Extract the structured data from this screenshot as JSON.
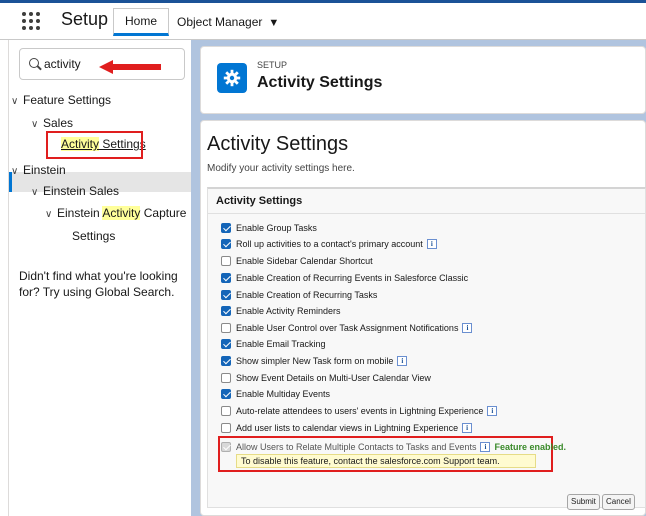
{
  "topbar": {
    "app_name": "Setup",
    "tabs": [
      {
        "label": "Home"
      },
      {
        "label": "Object Manager"
      }
    ]
  },
  "sidebar": {
    "search_value": "activity",
    "tree": {
      "feature_settings": "Feature Settings",
      "sales": "Sales",
      "activity_settings_a": "Activity",
      "activity_settings_b": " Settings",
      "einstein": "Einstein",
      "einstein_sales": "Einstein Sales",
      "eac_a": "Einstein ",
      "eac_b": "Activity",
      "eac_c": " Capture",
      "eac_settings": "Settings"
    },
    "help_text": "Didn't find what you're looking for? Try using Global Search."
  },
  "header": {
    "eyebrow": "SETUP",
    "title": "Activity Settings"
  },
  "main": {
    "title": "Activity Settings",
    "subtitle": "Modify your activity settings here.",
    "panel_title": "Activity Settings",
    "options": [
      {
        "label": "Enable Group Tasks",
        "checked": true,
        "info": false
      },
      {
        "label": "Roll up activities to a contact's primary account",
        "checked": true,
        "info": true
      },
      {
        "label": "Enable Sidebar Calendar Shortcut",
        "checked": false,
        "info": false
      },
      {
        "label": "Enable Creation of Recurring Events in Salesforce Classic",
        "checked": true,
        "info": false
      },
      {
        "label": "Enable Creation of Recurring Tasks",
        "checked": true,
        "info": false
      },
      {
        "label": "Enable Activity Reminders",
        "checked": true,
        "info": false
      },
      {
        "label": "Enable User Control over Task Assignment Notifications",
        "checked": false,
        "info": true
      },
      {
        "label": "Enable Email Tracking",
        "checked": true,
        "info": false
      },
      {
        "label": "Show simpler New Task form on mobile",
        "checked": true,
        "info": true
      },
      {
        "label": "Show Event Details on Multi-User Calendar View",
        "checked": false,
        "info": false
      },
      {
        "label": "Enable Multiday Events",
        "checked": true,
        "info": false
      },
      {
        "label": "Auto-relate attendees to users' events in Lightning Experience",
        "checked": false,
        "info": true
      },
      {
        "label": "Add user lists to calendar views in Lightning Experience",
        "checked": false,
        "info": true
      }
    ],
    "multi_contacts": {
      "label": "Allow Users to Relate Multiple Contacts to Tasks and Events",
      "status": "Feature enabled.",
      "note": "To disable this feature, contact the salesforce.com Support team."
    },
    "info_glyph": "i",
    "buttons": {
      "submit": "Submit",
      "cancel": "Cancel"
    }
  }
}
